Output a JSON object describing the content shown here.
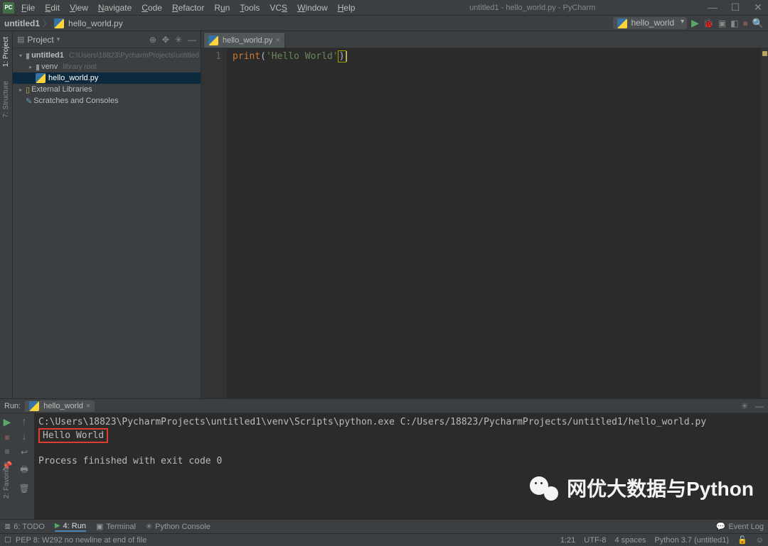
{
  "title": "untitled1 - hello_world.py - PyCharm",
  "menu": [
    "File",
    "Edit",
    "View",
    "Navigate",
    "Code",
    "Refactor",
    "Run",
    "Tools",
    "VCS",
    "Window",
    "Help"
  ],
  "breadcrumb": {
    "project": "untitled1",
    "file": "hello_world.py"
  },
  "runConfig": {
    "name": "hello_world"
  },
  "projectPanel": {
    "title": "Project",
    "rootName": "untitled1",
    "rootPath": "C:\\Users\\18823\\PycharmProjects\\untitled",
    "venv": "venv",
    "venvHint": "library root",
    "file": "hello_world.py",
    "extLibs": "External Libraries",
    "scratches": "Scratches and Consoles"
  },
  "leftTabs": {
    "project": "1: Project",
    "structure": "7: Structure",
    "favorites": "2: Favorites"
  },
  "editor": {
    "tab": "hello_world.py",
    "lineNo": "1",
    "kw": "print",
    "str": "'Hello World'"
  },
  "run": {
    "label": "Run:",
    "tab": "hello_world",
    "cmd": "C:\\Users\\18823\\PycharmProjects\\untitled1\\venv\\Scripts\\python.exe C:/Users/18823/PycharmProjects/untitled1/hello_world.py",
    "out": "Hello World",
    "exit": "Process finished with exit code 0"
  },
  "bottomTabs": {
    "todo": "6: TODO",
    "run": "4: Run",
    "terminal": "Terminal",
    "pyconsole": "Python Console",
    "eventLog": "Event Log"
  },
  "status": {
    "pep": "PEP 8: W292 no newline at end of file",
    "pos": "1:21",
    "enc": "UTF-8",
    "indent": "4 spaces",
    "interp": "Python 3.7 (untitled1)"
  },
  "watermark": "网优大数据与Python"
}
